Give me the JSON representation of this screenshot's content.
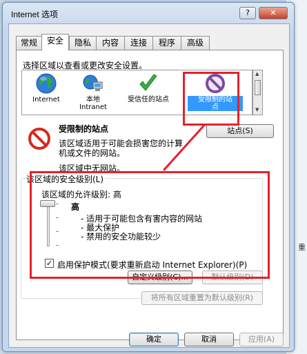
{
  "window": {
    "title": "Internet 选项",
    "help_label": "?",
    "close_label": "✕"
  },
  "tabs": [
    {
      "label": "常规"
    },
    {
      "label": "安全"
    },
    {
      "label": "隐私"
    },
    {
      "label": "内容"
    },
    {
      "label": "连接"
    },
    {
      "label": "程序"
    },
    {
      "label": "高级"
    }
  ],
  "security": {
    "instruction": "选择区域以查看或更改安全设置。",
    "zones": [
      {
        "label1": "Internet",
        "label2": "",
        "icon": "globe-icon"
      },
      {
        "label1": "本地",
        "label2": "Intranet",
        "icon": "intranet-icon"
      },
      {
        "label1": "受信任的站点",
        "label2": "",
        "icon": "checkmark-icon"
      },
      {
        "label1": "受限制的站",
        "label2": "点",
        "icon": "restricted-icon"
      }
    ],
    "zone_title": "受限制的站点",
    "zone_desc1": "该区域适用于可能会损害您的计算",
    "zone_desc2": "机或文件的网站。",
    "zone_empty": "该区域中无网站。",
    "sites_button": "站点(S)",
    "group_legend": "该区域的安全级别(L)",
    "allowed_level": "该区域的允许级别: 高",
    "level_name": "高",
    "level_bullets": [
      "- 适用于可能包含有害内容的网站",
      "- 最大保护",
      "- 禁用的安全功能较少"
    ],
    "protected_mode": "启用保护模式(要求重新启动 Internet Explorer)(P)",
    "protected_mode_checked": "✓",
    "custom_button": "自定义级别(C)...",
    "default_button": "默认级别(D)",
    "reset_all_button": "将所有区域重置为默认级别(R)"
  },
  "footer": {
    "ok": "确定",
    "cancel": "取消",
    "apply": "应用(A)"
  },
  "background": {
    "right_text": "重"
  },
  "colors": {
    "highlight": "#e5202a",
    "selection": "#3399ff"
  }
}
